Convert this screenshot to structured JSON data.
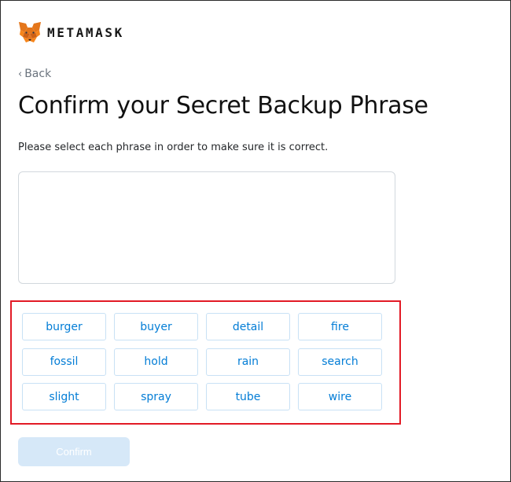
{
  "header": {
    "logo_icon": "metamask-fox-icon",
    "wordmark": "METAMASK"
  },
  "nav": {
    "back_label": "Back",
    "back_icon": "chevron-left-icon"
  },
  "page": {
    "title": "Confirm your Secret Backup Phrase",
    "instruction": "Please select each phrase in order to make sure it is correct."
  },
  "selected_phrase": [],
  "word_options": [
    "burger",
    "buyer",
    "detail",
    "fire",
    "fossil",
    "hold",
    "rain",
    "search",
    "slight",
    "spray",
    "tube",
    "wire"
  ],
  "actions": {
    "confirm_label": "Confirm",
    "confirm_enabled": false
  },
  "colors": {
    "accent_blue": "#037dd6",
    "word_border": "#c8e1f5",
    "disabled_button": "#d6e8f8",
    "highlight_red": "#e21b26"
  }
}
